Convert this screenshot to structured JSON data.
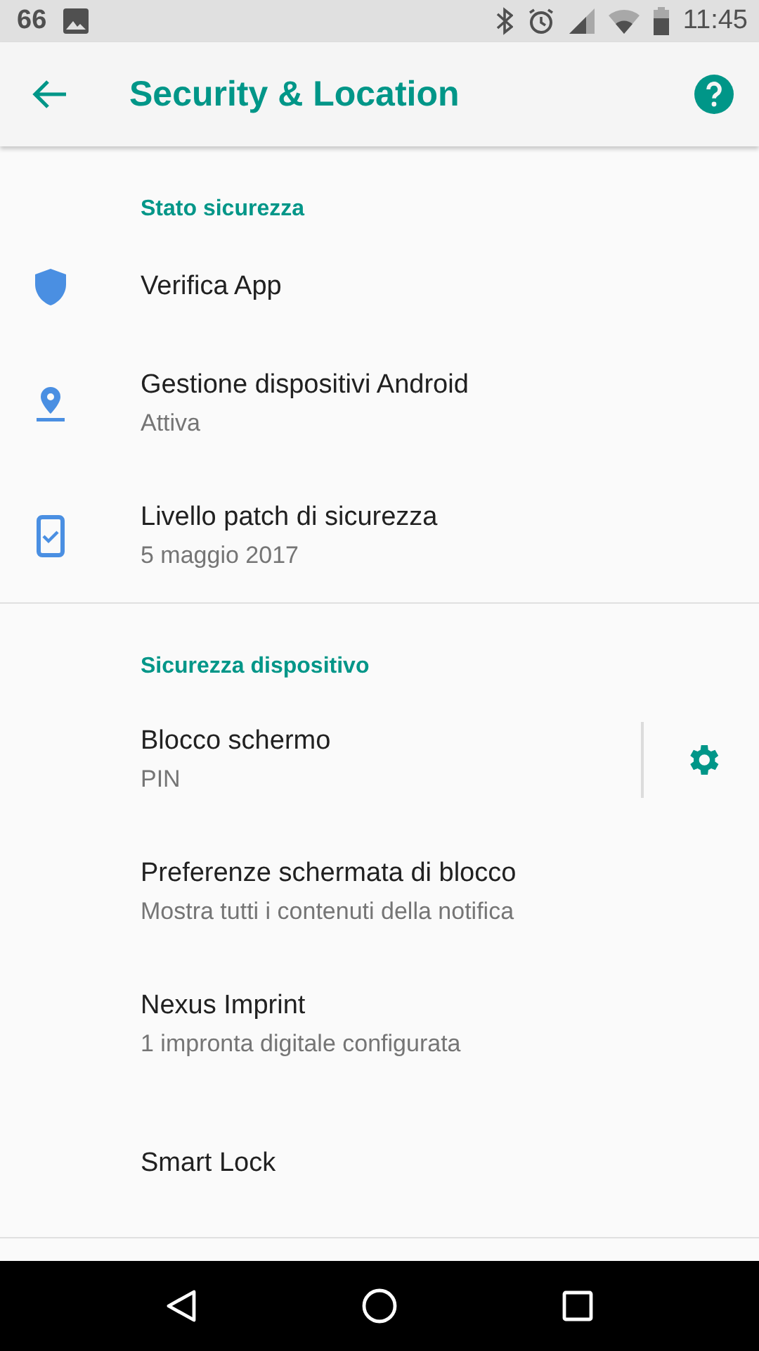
{
  "status_bar": {
    "notification_count": "66",
    "time": "11:45"
  },
  "app_bar": {
    "title": "Security & Location"
  },
  "sections": [
    {
      "header": "Stato sicurezza",
      "items": [
        {
          "kind": "shield",
          "title": "Verifica App"
        },
        {
          "kind": "location",
          "title": "Gestione dispositivi Android",
          "subtitle": "Attiva"
        },
        {
          "kind": "device",
          "title": "Livello patch di sicurezza",
          "subtitle": "5 maggio 2017"
        }
      ]
    },
    {
      "header": "Sicurezza dispositivo",
      "items": [
        {
          "kind": "settings",
          "title": "Blocco schermo",
          "subtitle": "PIN"
        },
        {
          "kind": "plain",
          "title": "Preferenze schermata di blocco",
          "subtitle": "Mostra tutti i contenuti della notifica"
        },
        {
          "kind": "plain",
          "title": "Nexus Imprint",
          "subtitle": "1 impronta digitale configurata"
        },
        {
          "kind": "plain",
          "title": "Smart Lock"
        }
      ]
    }
  ]
}
